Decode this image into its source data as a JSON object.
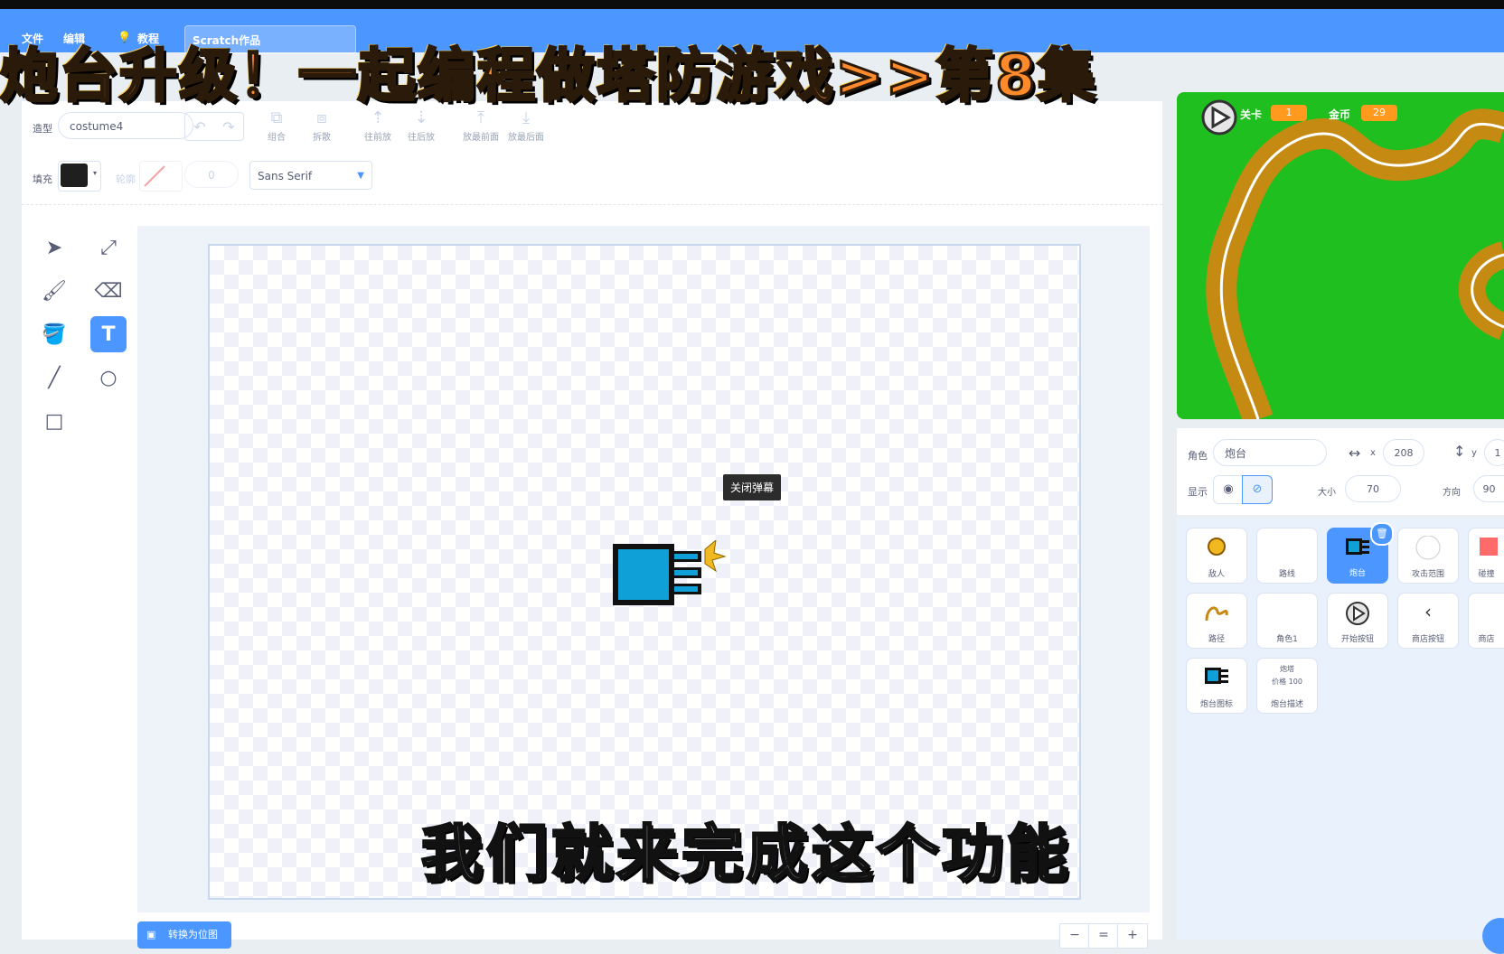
{
  "menu": {
    "file": "文件",
    "edit": "编辑",
    "tutorials": "教程",
    "project_title": "Scratch作品"
  },
  "banner": {
    "text": "炮台升级！一起编程做塔防游戏>>第8集"
  },
  "costume_editor": {
    "costume_label": "造型",
    "costume_name": "costume4",
    "group_label": "组合",
    "ungroup_label": "拆散",
    "forward_label": "往前放",
    "backward_label": "往后放",
    "front_label": "放最前面",
    "back_label": "放最后面",
    "fill_label": "填充",
    "outline_label": "轮廓",
    "outline_width": "0",
    "font_name": "Sans Serif",
    "fill_color": "#1f1f1f",
    "tooltip": "关闭弹幕",
    "convert_button": "转换为位图",
    "zoom_out": "−",
    "zoom_reset": "=",
    "zoom_in": "+"
  },
  "subtitle": "我们就来完成这个功能",
  "stage": {
    "level_label": "关卡",
    "level_value": "1",
    "coins_label": "金币",
    "coins_value": "29",
    "ground_color": "#1fbf1f",
    "path_color": "#c48a12"
  },
  "sprite_info": {
    "sprite_label": "角色",
    "sprite_name": "炮台",
    "x_label": "x",
    "x_value": "208",
    "y_label": "y",
    "y_value": "1",
    "show_label": "显示",
    "size_label": "大小",
    "size_value": "70",
    "direction_label": "方向",
    "direction_value": "90"
  },
  "sprites": [
    {
      "label": "敌人"
    },
    {
      "label": "路线"
    },
    {
      "label": "炮台"
    },
    {
      "label": "攻击范围"
    },
    {
      "label": "碰撞"
    },
    {
      "label": "路径"
    },
    {
      "label": "角色1"
    },
    {
      "label": "开始按钮"
    },
    {
      "label": "商店按钮"
    },
    {
      "label": "商店"
    },
    {
      "label": "炮台图标"
    },
    {
      "label": "炮台描述"
    }
  ],
  "sprite_desc_thumb": {
    "line1": "炮塔",
    "line2": "价格 100"
  }
}
